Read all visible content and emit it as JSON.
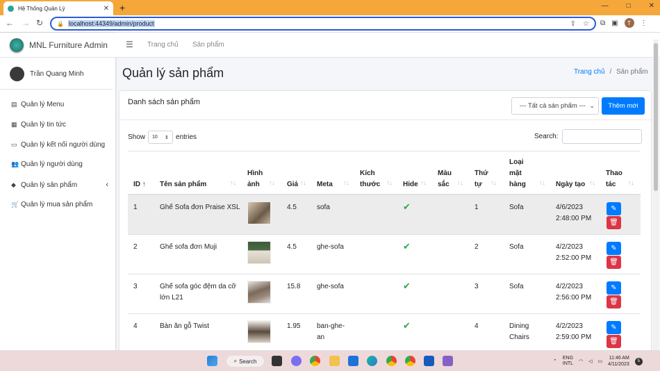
{
  "browser": {
    "tab_title": "Hệ Thống Quản Lý",
    "url": "localhost:44349/admin/product",
    "profile_initial": "T",
    "window_controls": [
      "—",
      "□",
      "✕"
    ]
  },
  "sidebar": {
    "brand": "MNL Furniture Admin",
    "user": "Trần Quang Minh",
    "items": [
      {
        "label": "Quản lý Menu",
        "icon": "menu-icon"
      },
      {
        "label": "Quản lý tin tức",
        "icon": "newspaper-icon"
      },
      {
        "label": "Quản lý kết nối người dùng",
        "icon": "connection-icon"
      },
      {
        "label": "Quản lý người dùng",
        "icon": "users-icon"
      },
      {
        "label": "Quản lý sản phẩm",
        "icon": "box-icon"
      },
      {
        "label": "Quản lý mua sản phẩm",
        "icon": "cart-icon"
      }
    ]
  },
  "navbar": {
    "links": [
      "Trang chủ",
      "Sản phẩm"
    ]
  },
  "page": {
    "title": "Quản lý sản phẩm",
    "breadcrumb": {
      "home": "Trang chủ",
      "sep": "/",
      "current": "Sản phẩm"
    }
  },
  "card": {
    "title": "Danh sách sản phẩm",
    "filter": "--- Tất cả sản phẩm ---",
    "add_button": "Thêm mới",
    "show_label": "Show",
    "page_size": "10",
    "entries_label": "entries",
    "search_label": "Search:"
  },
  "table": {
    "headers": [
      [
        "ID"
      ],
      [
        "Tên sản phẩm"
      ],
      [
        "Hình",
        "ảnh"
      ],
      [
        "Giá"
      ],
      [
        "Meta"
      ],
      [
        "Kích",
        "thước"
      ],
      [
        "Hide"
      ],
      [
        "Màu",
        "sắc"
      ],
      [
        "Thứ",
        "tự"
      ],
      [
        "Loại",
        "mặt",
        "hàng"
      ],
      [
        "Ngày tạo"
      ],
      [
        "Thao",
        "tác"
      ]
    ],
    "rows": [
      {
        "id": "1",
        "name": [
          "Ghế Sofa đơn Praise XSL"
        ],
        "price": "4.5",
        "meta": [
          "sofa"
        ],
        "hide": true,
        "order": "1",
        "type": [
          "Sofa"
        ],
        "date": [
          "4/6/2023",
          "2:48:00 PM"
        ]
      },
      {
        "id": "2",
        "name": [
          "Ghế sofa đơn Muji"
        ],
        "price": "4.5",
        "meta": [
          "ghe-sofa"
        ],
        "hide": true,
        "order": "2",
        "type": [
          "Sofa"
        ],
        "date": [
          "4/2/2023",
          "2:52:00 PM"
        ]
      },
      {
        "id": "3",
        "name": [
          "Ghế sofa góc đệm da cỡ",
          "lớn L21"
        ],
        "price": "15.8",
        "meta": [
          "ghe-sofa"
        ],
        "hide": true,
        "order": "3",
        "type": [
          "Sofa"
        ],
        "date": [
          "4/2/2023",
          "2:56:00 PM"
        ]
      },
      {
        "id": "4",
        "name": [
          "Bàn ăn gỗ Twist"
        ],
        "price": "1.95",
        "meta": [
          "ban-ghe-",
          "an"
        ],
        "hide": true,
        "order": "4",
        "type": [
          "Dining",
          "Chairs"
        ],
        "date": [
          "4/2/2023",
          "2:59:00 PM"
        ]
      }
    ]
  },
  "taskbar": {
    "search": "Search",
    "lang": [
      "ENG",
      "INTL"
    ],
    "time": "11:46 AM",
    "date": "4/11/2023",
    "badge": "5"
  }
}
